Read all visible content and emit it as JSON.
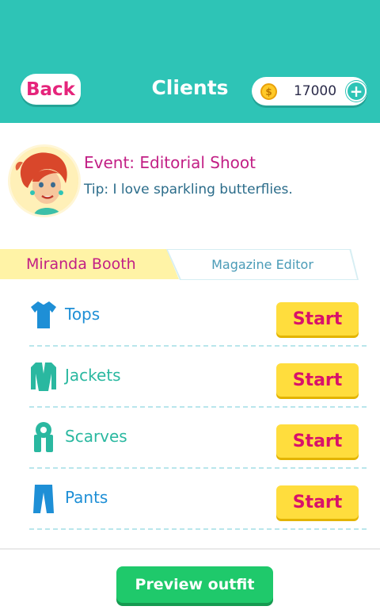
{
  "header": {
    "back_label": "Back",
    "title": "Clients",
    "coins": "17000",
    "coin_symbol": "$",
    "plus": "+"
  },
  "client": {
    "event": "Event: Editorial Shoot",
    "tip": "Tip: I love sparkling butterflies."
  },
  "tabs": {
    "active": "Miranda Booth",
    "inactive": "Magazine Editor"
  },
  "categories": [
    {
      "label": "Tops",
      "icon": "shirt-icon",
      "color": "#1e8fd6",
      "button": "Start"
    },
    {
      "label": "Jackets",
      "icon": "jacket-icon",
      "color": "#2ab8a0",
      "button": "Start"
    },
    {
      "label": "Scarves",
      "icon": "scarf-icon",
      "color": "#2ab8a0",
      "button": "Start"
    },
    {
      "label": "Pants",
      "icon": "pants-icon",
      "color": "#1e8fd6",
      "button": "Start"
    }
  ],
  "footer": {
    "preview_label": "Preview outfit"
  },
  "colors": {
    "header": "#2ec4b6",
    "accent_pink": "#c21f85",
    "start_yellow": "#ffdd3d",
    "preview_green": "#1fc96b"
  }
}
